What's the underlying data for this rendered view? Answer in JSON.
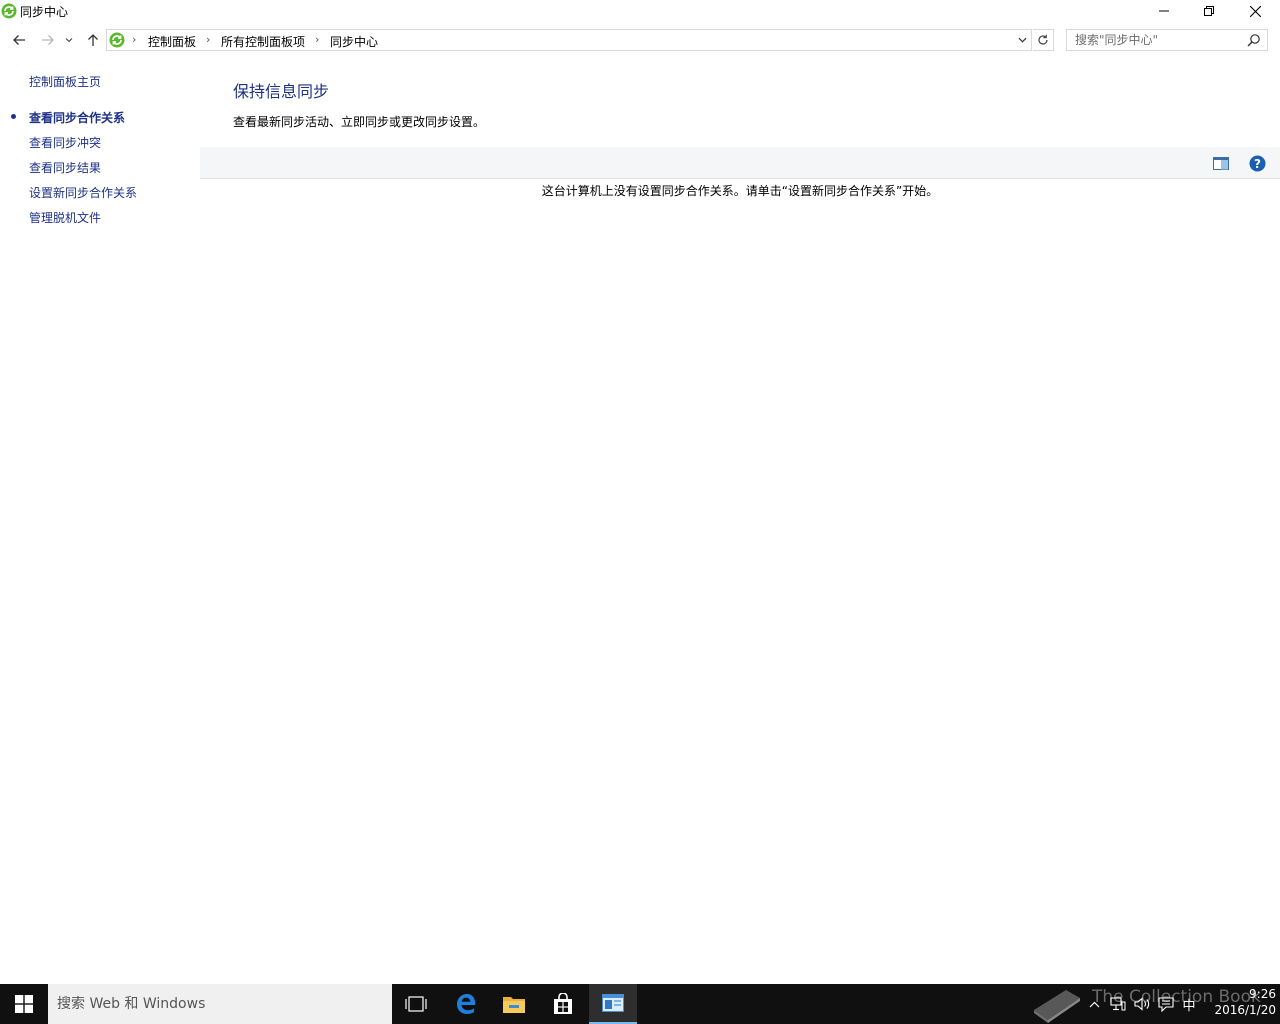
{
  "window": {
    "title": "同步中心",
    "controls": {
      "minimize": "minimize",
      "restore": "restore",
      "close": "close"
    }
  },
  "address": {
    "breadcrumbs": [
      "控制面板",
      "所有控制面板项",
      "同步中心"
    ],
    "search_placeholder": "搜索\"同步中心\""
  },
  "leftnav": {
    "home": "控制面板主页",
    "items": [
      {
        "label": "查看同步合作关系",
        "selected": true
      },
      {
        "label": "查看同步冲突",
        "selected": false
      },
      {
        "label": "查看同步结果",
        "selected": false
      },
      {
        "label": "设置新同步合作关系",
        "selected": false
      },
      {
        "label": "管理脱机文件",
        "selected": false
      }
    ]
  },
  "main": {
    "heading": "保持信息同步",
    "subtitle": "查看最新同步活动、立即同步或更改同步设置。",
    "empty_message": "这台计算机上没有设置同步合作关系。请单击“设置新同步合作关系”开始。"
  },
  "taskbar": {
    "search_placeholder": "搜索 Web 和 Windows",
    "ime": "中",
    "time": "9:26",
    "date": "2016/1/20",
    "watermark": "The Collection Book"
  },
  "colors": {
    "link": "#1e3287",
    "toolbar_bg": "#f5f6f7",
    "taskbar_bg": "#101010",
    "active_accent": "#76b9ed"
  }
}
